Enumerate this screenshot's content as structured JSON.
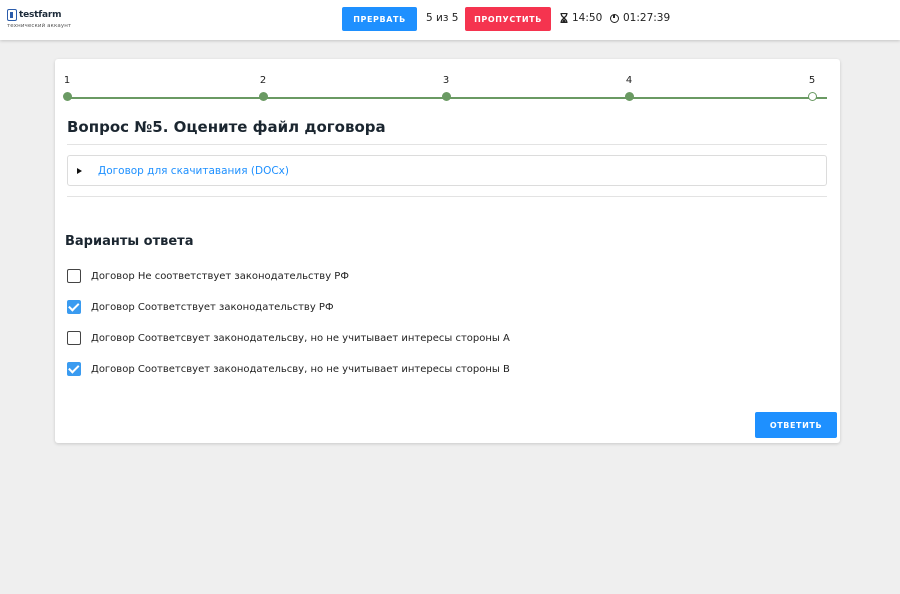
{
  "header": {
    "logo_text": "testfarm",
    "logo_sub": "технический аккаунт",
    "interrupt_label": "ПРЕРВАТЬ",
    "progress": "5 из 5",
    "skip_label": "ПРОПУСТИТЬ",
    "timer_question": "14:50",
    "timer_total": "01:27:39"
  },
  "steps": {
    "items": [
      {
        "label": "1",
        "done": true
      },
      {
        "label": "2",
        "done": true
      },
      {
        "label": "3",
        "done": true
      },
      {
        "label": "4",
        "done": true
      },
      {
        "label": "5",
        "done": false
      }
    ]
  },
  "question": {
    "title": "Вопрос №5. Оцените файл договора",
    "attachment_label": "Договор для скачитавания (DOCx)"
  },
  "answers": {
    "title": "Варианты ответа",
    "options": [
      {
        "label": "Договор Не соответствует законодательству РФ",
        "checked": false
      },
      {
        "label": "Договор Соответствует законодательству РФ",
        "checked": true
      },
      {
        "label": "Договор Соответсвует законодательсву, но не учитывает интересы стороны А",
        "checked": false
      },
      {
        "label": "Договор Соответсвует законодательсву, но не учитывает интересы стороны В",
        "checked": true
      }
    ]
  },
  "actions": {
    "answer_label": "ОТВЕТИТЬ"
  },
  "colors": {
    "primary": "#1e90ff",
    "danger": "#f5344f",
    "progress_line": "#6a9a63",
    "checkbox_checked": "#3a9bf0"
  },
  "icons": {
    "timer_question": "hourglass-icon",
    "timer_total": "clock-icon",
    "attachment": "caret-right-icon"
  }
}
